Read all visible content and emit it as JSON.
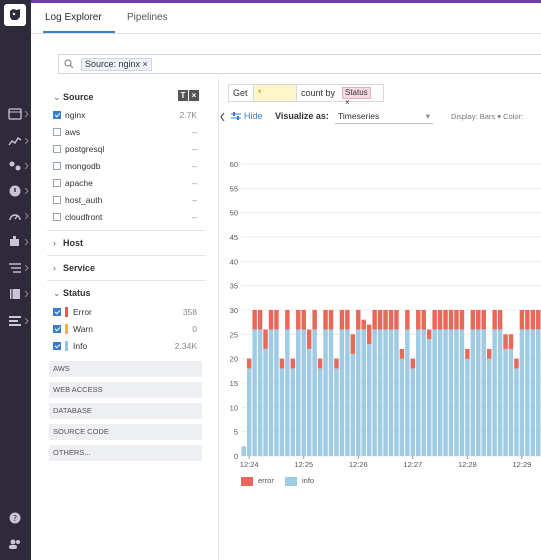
{
  "tabs": [
    {
      "label": "Log Explorer",
      "active": true
    },
    {
      "label": "Pipelines",
      "active": false
    }
  ],
  "search": {
    "chip": "Source: nginx ×"
  },
  "facets": {
    "source": {
      "title": "Source",
      "items": [
        {
          "label": "nginx",
          "count": "2.7K",
          "checked": true
        },
        {
          "label": "aws",
          "count": "–",
          "checked": false
        },
        {
          "label": "postgresql",
          "count": "–",
          "checked": false
        },
        {
          "label": "mongodb",
          "count": "–",
          "checked": false
        },
        {
          "label": "apache",
          "count": "–",
          "checked": false
        },
        {
          "label": "host_auth",
          "count": "–",
          "checked": false
        },
        {
          "label": "cloudfront",
          "count": "–",
          "checked": false
        }
      ]
    },
    "host_title": "Host",
    "service_title": "Service",
    "status": {
      "title": "Status",
      "items": [
        {
          "label": "Error",
          "count": "358",
          "color": "#e45c4c"
        },
        {
          "label": "Warn",
          "count": "0",
          "color": "#f0b13d"
        },
        {
          "label": "Info",
          "count": "2.34K",
          "color": "#8fc4e2"
        }
      ]
    },
    "groups": [
      "AWS",
      "WEB ACCESS",
      "DATABASE",
      "SOURCE CODE",
      "OTHERS..."
    ]
  },
  "viz": {
    "get_label": "Get",
    "measure": "*",
    "agg_label": "count by",
    "group_chip": "Status ×",
    "hide_label": "Hide",
    "visualize_label": "Visualize as:",
    "visualize_value": "Timeseries",
    "display_label": "Display:  Bars ▾     Color:"
  },
  "colors": {
    "error": "#e8695a",
    "info": "#9fcbe4",
    "accent": "#3a7dc9",
    "brand": "#6c3fb5"
  },
  "chart_data": {
    "type": "bar",
    "stacked": true,
    "ylim": [
      0,
      60
    ],
    "yticks": [
      0,
      5,
      10,
      15,
      20,
      25,
      30,
      35,
      40,
      45,
      50,
      55,
      60
    ],
    "xtick_labels": [
      "12:24",
      "12:25",
      "12:26",
      "12:27",
      "12:28",
      "12:29"
    ],
    "series": [
      {
        "name": "error",
        "values": [
          0,
          2,
          4,
          4,
          4,
          4,
          4,
          2,
          4,
          2,
          4,
          4,
          4,
          4,
          2,
          4,
          4,
          2,
          4,
          4,
          4,
          4,
          2,
          4,
          4,
          4,
          4,
          4,
          4,
          2,
          4,
          2,
          4,
          4,
          2,
          4,
          4,
          4,
          4,
          4,
          4,
          2,
          4,
          4,
          4,
          2,
          4,
          4,
          3,
          3,
          2,
          4,
          4,
          4,
          4
        ]
      },
      {
        "name": "info",
        "values": [
          2,
          18,
          26,
          26,
          22,
          26,
          26,
          18,
          26,
          18,
          26,
          26,
          22,
          26,
          18,
          26,
          26,
          18,
          26,
          26,
          21,
          26,
          26,
          23,
          26,
          26,
          26,
          26,
          26,
          20,
          26,
          18,
          26,
          26,
          24,
          26,
          26,
          26,
          26,
          26,
          26,
          20,
          26,
          26,
          26,
          20,
          26,
          26,
          22,
          22,
          18,
          26,
          26,
          26,
          26
        ]
      }
    ],
    "legend": [
      "error",
      "info"
    ]
  }
}
